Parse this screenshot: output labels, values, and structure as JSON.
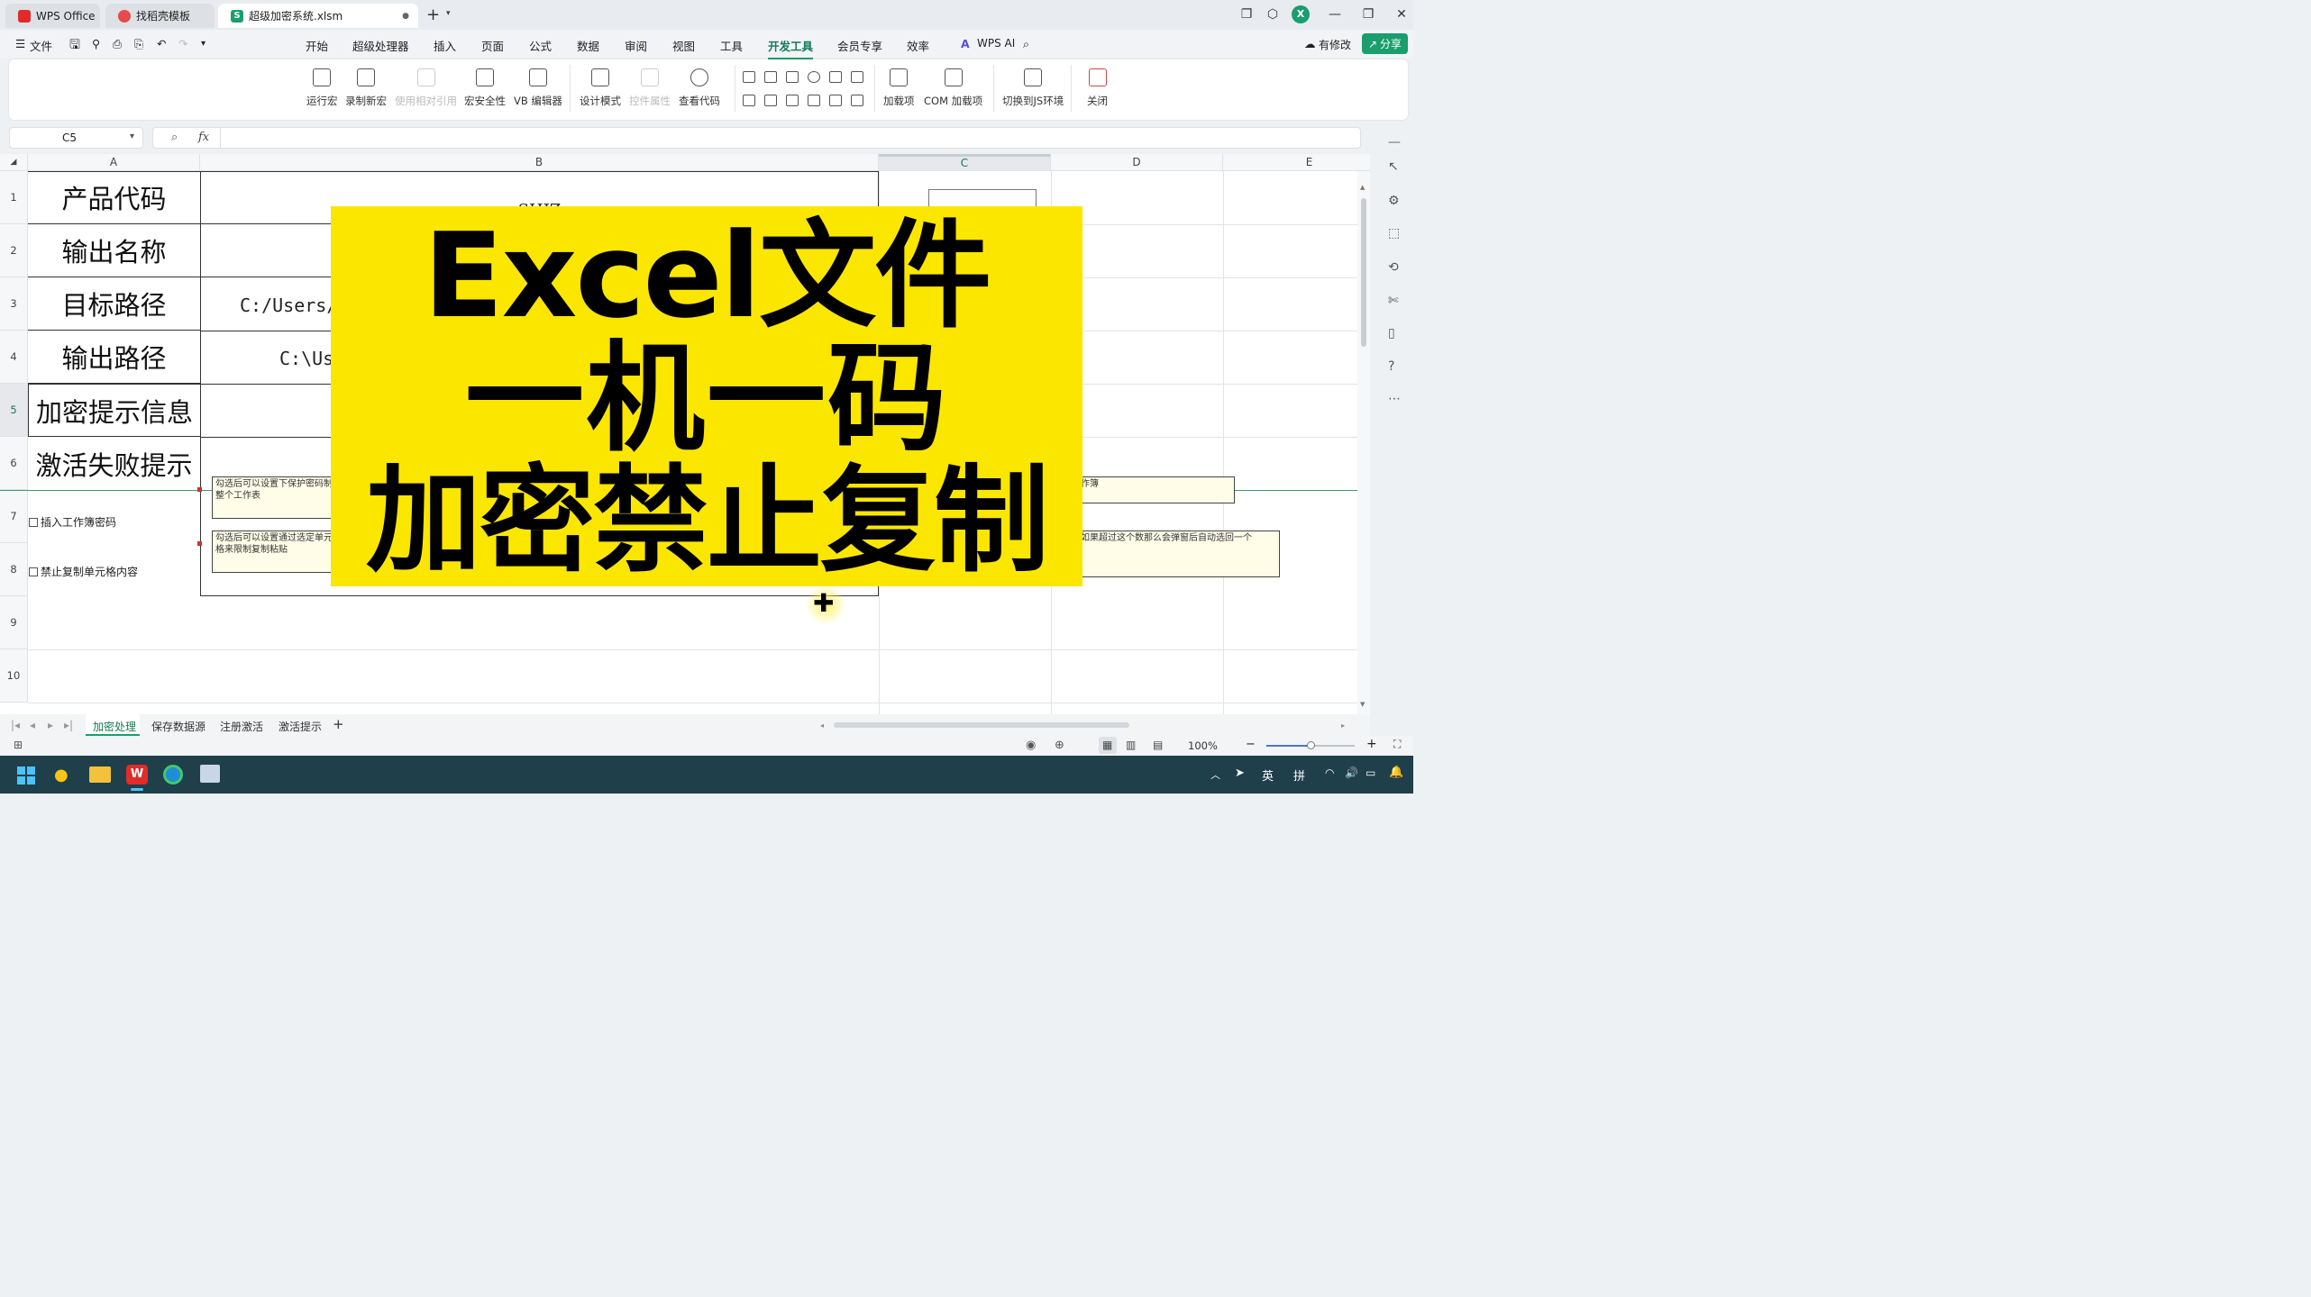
{
  "window": {
    "tabs": [
      {
        "label": "WPS Office",
        "icon": "wps-logo-icon"
      },
      {
        "label": "找稻壳模板",
        "icon": "docer-icon"
      },
      {
        "label": "超级加密系统.xlsm",
        "icon": "spreadsheet-s-icon"
      }
    ],
    "new_tab": "+"
  },
  "menu": {
    "file": "文件",
    "items": [
      "开始",
      "超级处理器",
      "插入",
      "页面",
      "公式",
      "数据",
      "审阅",
      "视图",
      "工具",
      "开发工具",
      "会员专享",
      "效率"
    ],
    "active": "开发工具",
    "wps_ai": "WPS AI",
    "modified": "有修改",
    "share": "分享"
  },
  "ribbon": {
    "buttons": [
      {
        "label": "运行宏",
        "enabled": true
      },
      {
        "label": "录制新宏",
        "enabled": true
      },
      {
        "label": "使用相对引用",
        "enabled": false
      },
      {
        "label": "宏安全性",
        "enabled": true
      },
      {
        "label": "VB 编辑器",
        "enabled": true
      },
      {
        "label": "设计模式",
        "enabled": true
      },
      {
        "label": "控件属性",
        "enabled": false
      },
      {
        "label": "查看代码",
        "enabled": true
      },
      {
        "label": "加载项",
        "enabled": true
      },
      {
        "label": "COM 加载项",
        "enabled": true
      },
      {
        "label": "切换到JS环境",
        "enabled": true
      },
      {
        "label": "关闭",
        "enabled": true
      }
    ]
  },
  "formula_bar": {
    "cell_ref": "C5",
    "fx": "fx",
    "value": ""
  },
  "sheet": {
    "columns": [
      "A",
      "B",
      "C",
      "D",
      "E"
    ],
    "rows": [
      "1",
      "2",
      "3",
      "4",
      "5",
      "6",
      "7",
      "8",
      "9",
      "10"
    ],
    "labels": [
      "产品代码",
      "输出名称",
      "目标路径",
      "输出路径",
      "加密提示信息",
      "激活失败提示"
    ],
    "b_values": [
      "SHJZ",
      "",
      "C:/Users/",
      "C:\\Us",
      "",
      ""
    ],
    "checkboxes": [
      {
        "label": "插入工作簿密码",
        "checked": false
      },
      {
        "label": "禁止复制单元格内容",
        "checked": false
      }
    ],
    "notes": [
      "勾选后可以设置下保护密码制整个工作表",
      "勾选后可以设置通过选定单元格来限制复制粘贴",
      "作簿",
      "如果超过这个数那么会弹窗后自动选回一个"
    ]
  },
  "banner": {
    "line1": "Excel文件",
    "line2": "一机一码",
    "line3": "加密禁止复制",
    "bg": "#fbe600"
  },
  "sheet_tabs": {
    "tabs": [
      "加密处理",
      "保存数据源",
      "注册激活",
      "激活提示"
    ],
    "active": "加密处理",
    "add": "+"
  },
  "status": {
    "zoom": "100%"
  },
  "taskbar": {
    "ime_lang": "英",
    "ime_mode": "拼"
  },
  "colors": {
    "accent": "#1a9e6e",
    "banner": "#fbe600",
    "taskbar": "#1f3f4b"
  }
}
